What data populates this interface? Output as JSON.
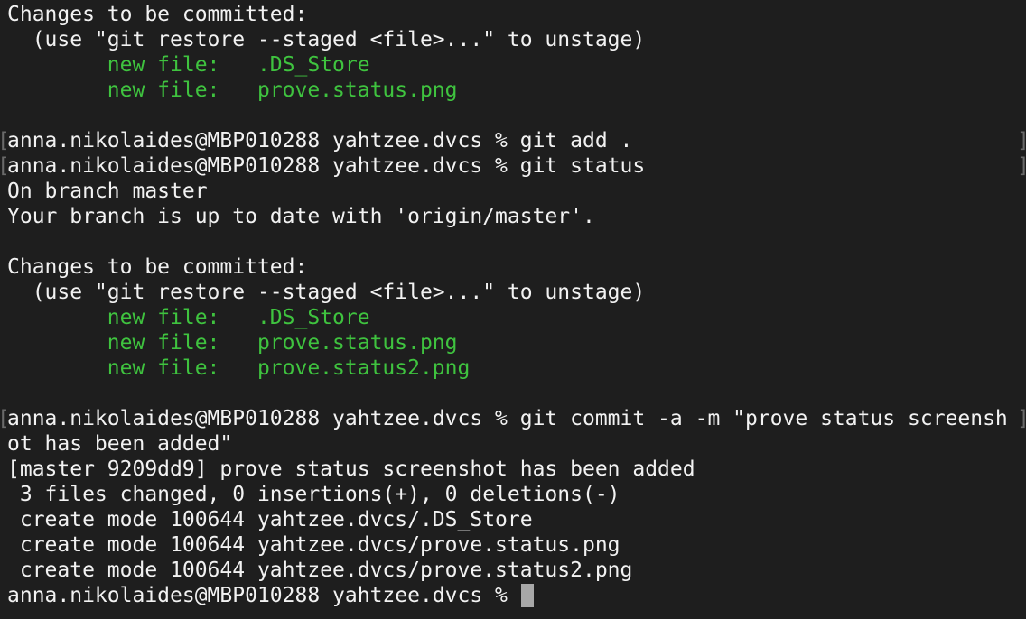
{
  "terminal": {
    "prompt": "anna.nikolaides@MBP010288 yahtzee.dvcs % ",
    "lines": [
      {
        "text": "Changes to be committed:",
        "color": "default"
      },
      {
        "text": "  (use \"git restore --staged <file>...\" to unstage)",
        "color": "default"
      },
      {
        "text": "        new file:   .DS_Store",
        "color": "green"
      },
      {
        "text": "        new file:   prove.status.png",
        "color": "green"
      },
      {
        "text": "",
        "color": "default"
      },
      {
        "text": "anna.nikolaides@MBP010288 yahtzee.dvcs % git add .",
        "color": "default"
      },
      {
        "text": "anna.nikolaides@MBP010288 yahtzee.dvcs % git status",
        "color": "default"
      },
      {
        "text": "On branch master",
        "color": "default"
      },
      {
        "text": "Your branch is up to date with 'origin/master'.",
        "color": "default"
      },
      {
        "text": "",
        "color": "default"
      },
      {
        "text": "Changes to be committed:",
        "color": "default"
      },
      {
        "text": "  (use \"git restore --staged <file>...\" to unstage)",
        "color": "default"
      },
      {
        "text": "        new file:   .DS_Store",
        "color": "green"
      },
      {
        "text": "        new file:   prove.status.png",
        "color": "green"
      },
      {
        "text": "        new file:   prove.status2.png",
        "color": "green"
      },
      {
        "text": "",
        "color": "default"
      },
      {
        "text": "anna.nikolaides@MBP010288 yahtzee.dvcs % git commit -a -m \"prove status screensh",
        "color": "default"
      },
      {
        "text": "ot has been added\"",
        "color": "default"
      },
      {
        "text": "[master 9209dd9] prove status screenshot has been added",
        "color": "default"
      },
      {
        "text": " 3 files changed, 0 insertions(+), 0 deletions(-)",
        "color": "default"
      },
      {
        "text": " create mode 100644 yahtzee.dvcs/.DS_Store",
        "color": "default"
      },
      {
        "text": " create mode 100644 yahtzee.dvcs/prove.status.png",
        "color": "default"
      },
      {
        "text": " create mode 100644 yahtzee.dvcs/prove.status2.png",
        "color": "default"
      }
    ]
  },
  "colors": {
    "background": "#1e1e1e",
    "foreground": "#f2f2f2",
    "staged_file": "#3fc33f",
    "cursor": "#a8a8a8"
  }
}
